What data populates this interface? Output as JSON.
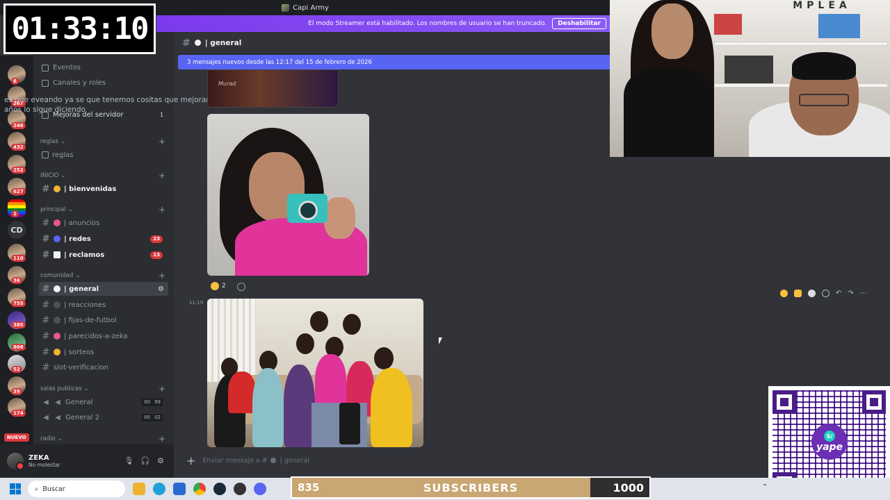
{
  "window": {
    "title": "Capi Army"
  },
  "streamer_banner": {
    "text": "El modo Streamer está habilitado. Los nombres de usuario se han truncado.",
    "button": "Deshabilitar"
  },
  "timer": "01:33:10",
  "overlay_text": "es que eveando ya se que tenemos cositas que mejorar desde hace 2 años lo sigue diciendo",
  "server": {
    "name": "Capi Army",
    "menu": [
      "Eventos",
      "Canales y roles",
      "Mejoras del servidor"
    ],
    "boost_count": "1"
  },
  "guild_badges": [
    "6",
    "267",
    "246",
    "432",
    "252",
    "627",
    "1",
    "110",
    "36",
    "755",
    "385",
    "808",
    "52",
    "39",
    "174"
  ],
  "guild_text_icon": "CD",
  "nuevo_label": "NUEVO",
  "categories": {
    "reglas": "reglas",
    "inicio": "INICIO",
    "principal": "principal",
    "comunidad": "comunidad",
    "salas": "salas publicas",
    "radio": "radio"
  },
  "channels": {
    "reglas": "reglas",
    "bienvenidas": "| bienvenidas",
    "anuncios": "| anuncios",
    "redes": "| redes",
    "redes_count": "23",
    "reclamos": "| reclamos",
    "reclamos_count": "13",
    "general": "| general",
    "reacciones": "| reacciones",
    "fijas": "| fijas-de-futbol",
    "parecidos": "| parecidos-a-zeka",
    "sorteos": "| sorteos",
    "slot": "slot-verificacion",
    "voice1": "General",
    "voice1_a": "00",
    "voice1_b": "99",
    "voice2": "General 2",
    "voice2_a": "00",
    "voice2_b": "02"
  },
  "user": {
    "name": "ZEKA",
    "status": "No molestar"
  },
  "header": {
    "channel": "| general"
  },
  "new_messages_bar": "3 mensajes nuevos desde las 12:17 del 15 de febrero de 2026",
  "image1_caption": "Murad",
  "reaction": {
    "count": "2"
  },
  "message_time": "11:19",
  "chat_input_placeholder": "Enviar mensaje a #",
  "chat_input_channel": "| general",
  "taskbar": {
    "search_placeholder": "Buscar"
  },
  "subscribers": {
    "current": "835",
    "label": "SUBSCRIBERS",
    "goal": "1000",
    "progress": 0.835
  },
  "webcam_sign": "MPLEA",
  "qr_brand": "yape",
  "qr_symbol": "S/",
  "colors": {
    "accent": "#5865f2",
    "streamer_banner": "#7c3aed",
    "badge": "#da373c",
    "sub_fill": "#c9a672"
  }
}
